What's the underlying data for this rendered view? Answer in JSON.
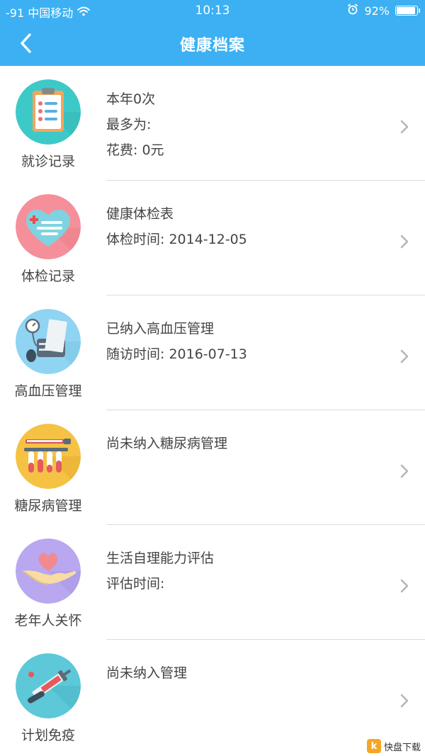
{
  "status_bar": {
    "carrier": "-91 中国移动",
    "time": "10:13",
    "battery_label": "92%",
    "battery_level": 0.92
  },
  "header": {
    "title": "健康档案"
  },
  "records": [
    {
      "label": "就诊记录",
      "icon": "clipboard-icon",
      "lines": [
        "本年0次",
        "最多为:",
        "花费: 0元"
      ]
    },
    {
      "label": "体检记录",
      "icon": "heart-icon",
      "lines": [
        "健康体检表",
        "体检时间: 2014-12-05"
      ]
    },
    {
      "label": "高血压管理",
      "icon": "blood-pressure-icon",
      "lines": [
        "已纳入高血压管理",
        "随访时间: 2016-07-13"
      ]
    },
    {
      "label": "糖尿病管理",
      "icon": "test-tube-icon",
      "lines": [
        "尚未纳入糖尿病管理"
      ]
    },
    {
      "label": "老年人关怀",
      "icon": "heart-hand-icon",
      "lines": [
        "生活自理能力评估",
        "评估时间:"
      ]
    },
    {
      "label": "计划免疫",
      "icon": "syringe-icon",
      "lines": [
        "尚未纳入管理"
      ]
    }
  ],
  "colors": {
    "header_bg": "#3cb0f2",
    "clipboard_bg": "#3ec9c9",
    "heart_bg": "#f5909a",
    "bp_bg": "#8fd4f2",
    "tube_bg": "#f5c244",
    "hand_bg": "#b9a8f0",
    "syringe_bg": "#5cc8d8"
  },
  "watermark": {
    "logo": "k",
    "text": "快盘下载"
  }
}
